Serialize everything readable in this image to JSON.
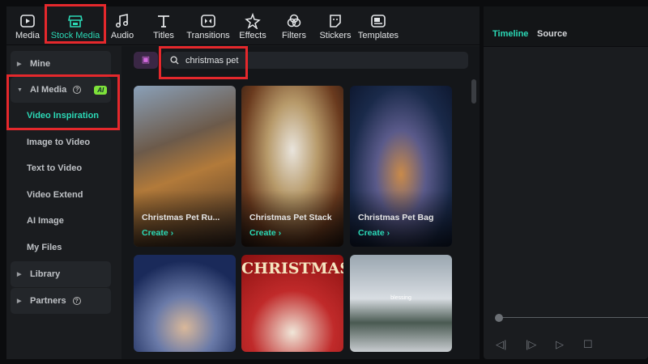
{
  "toolbar": {
    "items": [
      {
        "label": "Media",
        "icon": "media-icon"
      },
      {
        "label": "Stock Media",
        "icon": "store-icon",
        "active": true
      },
      {
        "label": "Audio",
        "icon": "music-note-icon"
      },
      {
        "label": "Titles",
        "icon": "text-t-icon"
      },
      {
        "label": "Transitions",
        "icon": "transition-icon"
      },
      {
        "label": "Effects",
        "icon": "sparkle-icon"
      },
      {
        "label": "Filters",
        "icon": "filter-icon"
      },
      {
        "label": "Stickers",
        "icon": "sticker-icon"
      },
      {
        "label": "Templates",
        "icon": "template-icon"
      }
    ]
  },
  "sidebar": {
    "mine": "Mine",
    "ai_media": "AI Media",
    "ai_badge": "AI",
    "sub": [
      "Video Inspiration",
      "Image to Video",
      "Text to Video",
      "Video Extend",
      "AI Image",
      "My Files"
    ],
    "library": "Library",
    "partners": "Partners"
  },
  "search": {
    "value": "christmas pet"
  },
  "cards": [
    {
      "title": "Christmas Pet Ru...",
      "action": "Create"
    },
    {
      "title": "Christmas Pet Stack",
      "action": "Create"
    },
    {
      "title": "Christmas Pet Bag",
      "action": "Create"
    },
    {
      "title": "",
      "action": ""
    },
    {
      "title": "CHRISTMAS",
      "action": ""
    },
    {
      "title": "blessing",
      "action": ""
    }
  ],
  "right": {
    "tabs": [
      "Timeline",
      "Source"
    ]
  },
  "colors": {
    "accent": "#2bd9b6",
    "highlight": "#e5282c"
  }
}
